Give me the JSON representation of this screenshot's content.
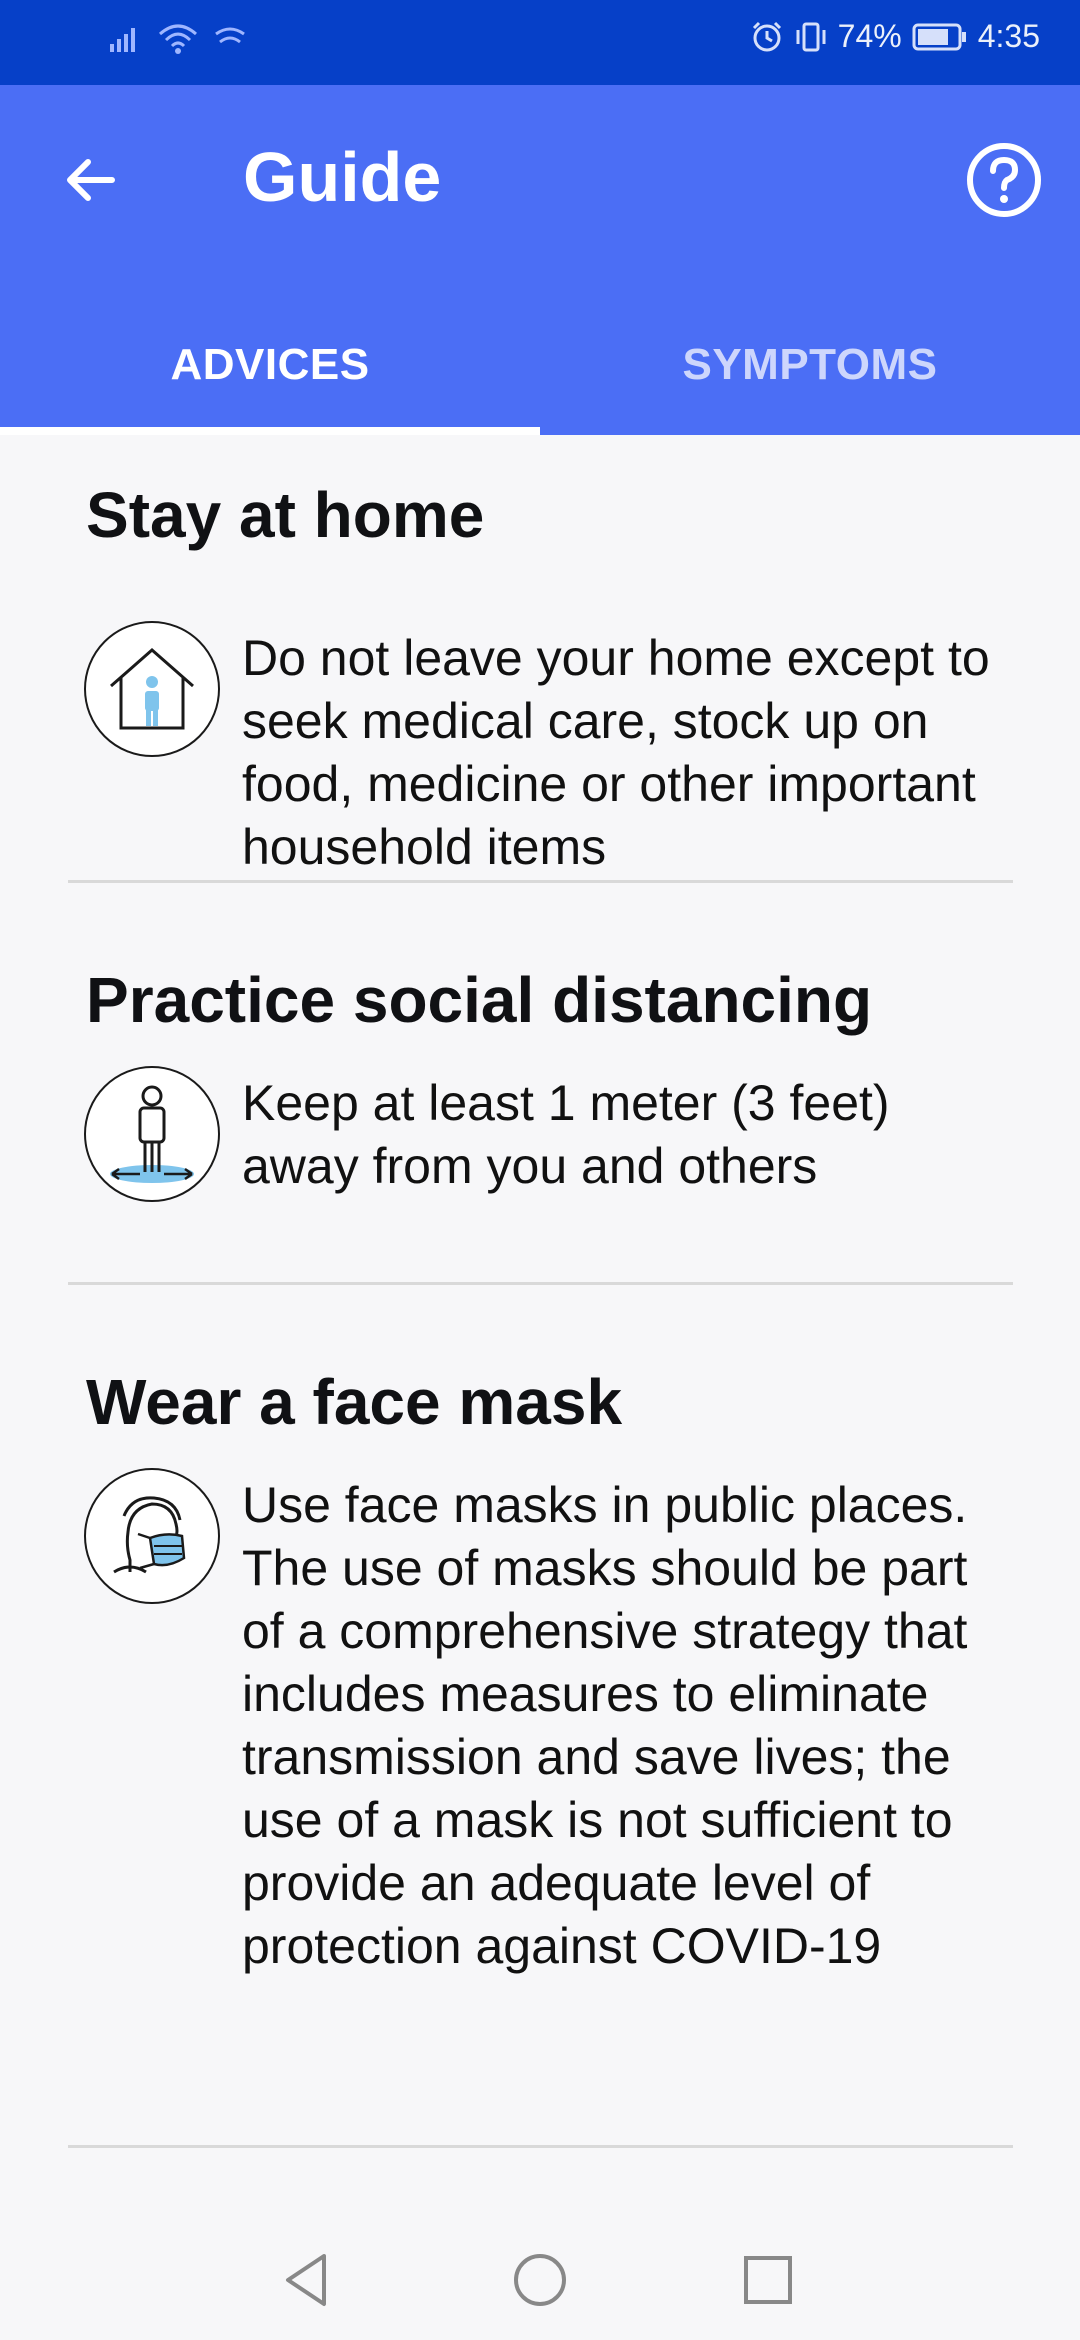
{
  "status_bar": {
    "battery": "74%",
    "time": "4:35",
    "icons": [
      "signal-icon",
      "wifi-icon",
      "data-icon",
      "alarm-icon",
      "vibrate-icon",
      "battery-icon"
    ]
  },
  "app_bar": {
    "title": "Guide",
    "back_icon": "arrow-left-icon",
    "help_icon": "help-circle-icon",
    "color": "#4b6ef5"
  },
  "tabs": [
    {
      "label": "ADVICES",
      "selected": true
    },
    {
      "label": "SYMPTOMS",
      "selected": false
    }
  ],
  "advices": [
    {
      "title": "Stay at home",
      "icon": "home-person-icon",
      "text": "Do not leave your home except to seek medical care, stock up on food, medicine or other important household items"
    },
    {
      "title": "Practice social distancing",
      "icon": "social-distance-icon",
      "text": "Keep at least 1 meter (3 feet) away from you and others"
    },
    {
      "title": "Wear a face mask",
      "icon": "face-mask-icon",
      "text": "Use face masks in public places. The use of masks should be part of a comprehensive strategy that includes measures to eliminate transmission and save lives; the use of a mask is not sufficient to provide an adequate level of protection against COVID-19"
    }
  ],
  "nav_bar": {
    "buttons": [
      "back-triangle-icon",
      "home-circle-icon",
      "recents-square-icon"
    ]
  },
  "colors": {
    "status_bar": "#0640c8",
    "accent": "#4b6ef5",
    "illustration_blue": "#7fc4ec"
  }
}
